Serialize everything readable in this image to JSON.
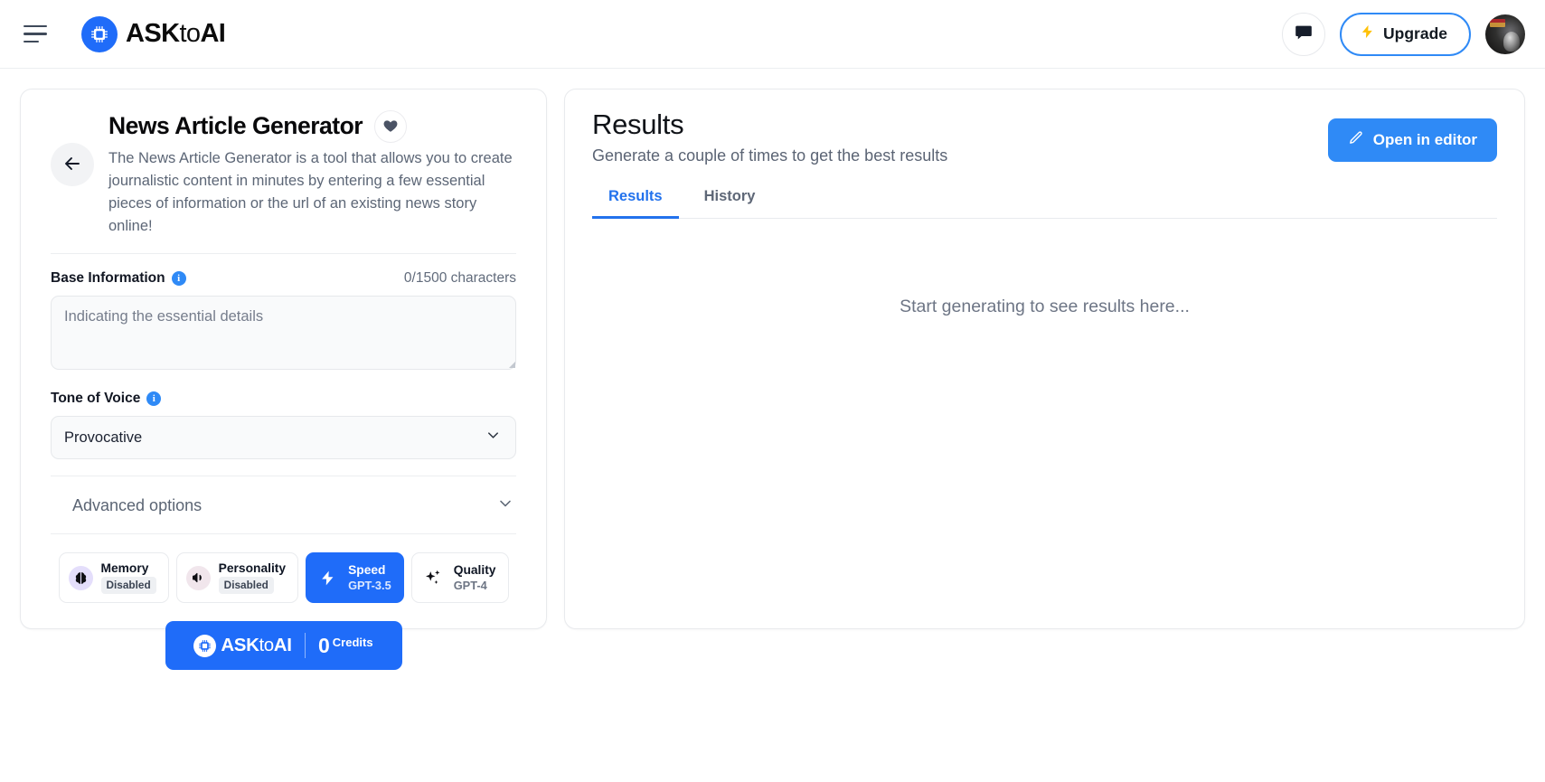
{
  "header": {
    "menu_icon": "hamburger-icon",
    "brand_upper": "ASK",
    "brand_lower": "to",
    "brand_upper2": "AI",
    "chat_icon": "chat-bubble-icon",
    "upgrade_label": "Upgrade",
    "upgrade_icon": "lightning-bolt-icon",
    "avatar_label": "user-avatar"
  },
  "tool": {
    "back_icon": "arrow-left-icon",
    "title": "News Article Generator",
    "favorite_icon": "heart-icon",
    "description": "The News Article Generator is a tool that allows you to create journalistic content in minutes by entering a few essential pieces of information or the url of an existing news story online!",
    "base_information": {
      "label": "Base Information",
      "info_icon": "info-icon",
      "counter": "0/1500 characters",
      "placeholder": "Indicating the essential details",
      "value": ""
    },
    "tone_of_voice": {
      "label": "Tone of Voice",
      "info_icon": "info-icon",
      "selected": "Provocative",
      "options": [
        "Provocative"
      ],
      "chevron_icon": "chevron-down-icon"
    },
    "advanced_options": {
      "label": "Advanced options",
      "chevron_icon": "chevron-down-icon"
    },
    "chips": [
      {
        "name": "memory",
        "icon": "brain-icon",
        "title": "Memory",
        "sub": "Disabled",
        "sub_style": "badge",
        "active": false
      },
      {
        "name": "personality",
        "icon": "megaphone-icon",
        "title": "Personality",
        "sub": "Disabled",
        "sub_style": "badge",
        "active": false
      },
      {
        "name": "speed",
        "icon": "lightning-bolt-icon",
        "title": "Speed",
        "sub": "GPT-3.5",
        "sub_style": "plain",
        "active": true
      },
      {
        "name": "quality",
        "icon": "sparkles-icon",
        "title": "Quality",
        "sub": "GPT-4",
        "sub_style": "plain",
        "active": false
      }
    ],
    "credits_button": {
      "brand_upper": "ASK",
      "brand_lower": "to",
      "brand_upper2": "AI",
      "amount": "0",
      "word": "Credits"
    }
  },
  "results": {
    "title": "Results",
    "subtitle": "Generate a couple of times to get the best results",
    "open_editor_label": "Open in editor",
    "open_editor_icon": "pencil-icon",
    "tabs": [
      {
        "label": "Results",
        "active": true
      },
      {
        "label": "History",
        "active": false
      }
    ],
    "empty_message": "Start generating to see results here..."
  },
  "colors": {
    "brand_blue": "#1f6cf9",
    "accent_blue": "#2f8af6",
    "tab_blue": "#2272ed",
    "bolt_yellow": "#ffc107",
    "muted_text": "#5c6676"
  }
}
